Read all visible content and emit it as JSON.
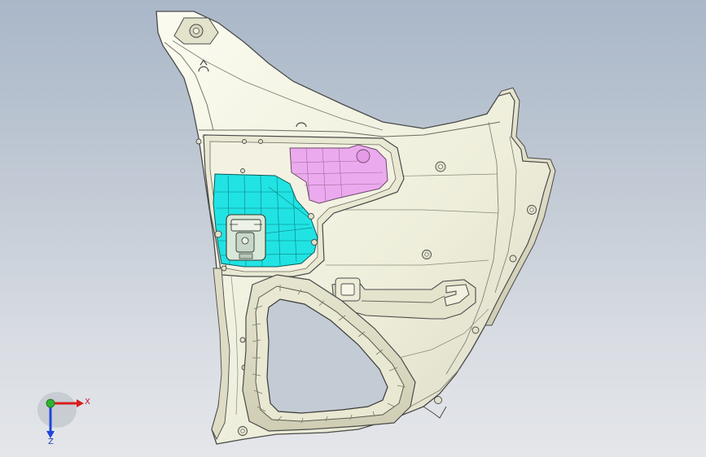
{
  "viewport": {
    "background_top": "#a9b7c8",
    "background_bottom": "#e4e6ea"
  },
  "model": {
    "panel_color": "#f1f0df",
    "edge_color": "#4a4a4a",
    "highlight_cyan": "#21e3e3",
    "highlight_pink": "#ecaaee"
  },
  "triad": {
    "x_label": "X",
    "z_label": "Z",
    "x_color": "#d81e1e",
    "y_color": "#2fb42f",
    "z_color": "#1e46d8"
  }
}
